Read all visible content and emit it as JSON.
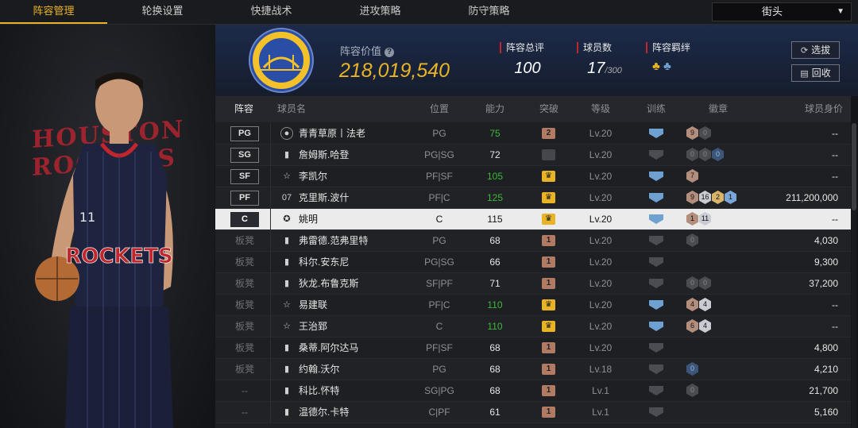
{
  "tabs": [
    {
      "label": "阵容管理",
      "active": true
    },
    {
      "label": "轮换设置",
      "active": false
    },
    {
      "label": "快捷战术",
      "active": false
    },
    {
      "label": "进攻策略",
      "active": false
    },
    {
      "label": "防守策略",
      "active": false
    }
  ],
  "mode_select": {
    "value": "街头"
  },
  "art": {
    "team_text": "HOUSTON ROCKETS",
    "jersey_text": "ROCKETS",
    "jersey_number": "11"
  },
  "header": {
    "value_label": "阵容价值",
    "value": "218,019,540",
    "overall_label": "阵容总评",
    "overall": "100",
    "players_label": "球员数",
    "players": "17",
    "players_max": "/300",
    "bond_label": "阵容羁绊",
    "select_btn": "选拔",
    "recycle_btn": "回收"
  },
  "columns": [
    "阵容",
    "球员名",
    "位置",
    "能力",
    "突破",
    "等级",
    "训练",
    "徽章",
    "球员身价"
  ],
  "rows": [
    {
      "slot": "PG",
      "bench": false,
      "icon": "person",
      "name": "青青草原丨法老",
      "pos": "PG",
      "ability": "75",
      "green": true,
      "brk": "2",
      "brkType": "copper",
      "level": "Lv.20",
      "train": "blue",
      "badges": [
        [
          "copper",
          "9"
        ],
        [
          "dark",
          "0"
        ]
      ],
      "price": "--"
    },
    {
      "slot": "SG",
      "bench": false,
      "icon": "bars",
      "name": "詹姆斯.哈登",
      "pos": "PG|SG",
      "ability": "72",
      "green": false,
      "brk": "",
      "brkType": "dark",
      "level": "Lv.20",
      "train": "gray",
      "badges": [
        [
          "dark",
          "0"
        ],
        [
          "dark",
          "0"
        ],
        [
          "navy",
          "0"
        ]
      ],
      "price": "--"
    },
    {
      "slot": "SF",
      "bench": false,
      "icon": "star",
      "name": "李凯尔",
      "pos": "PF|SF",
      "ability": "105",
      "green": true,
      "brk": "♛",
      "brkType": "gold",
      "level": "Lv.20",
      "train": "blue",
      "badges": [
        [
          "copper",
          "7"
        ]
      ],
      "price": "--"
    },
    {
      "slot": "PF",
      "bench": false,
      "icon": "07",
      "name": "克里斯.波什",
      "pos": "PF|C",
      "ability": "125",
      "green": true,
      "brk": "♛",
      "brkType": "gold",
      "level": "Lv.20",
      "train": "blue",
      "badges": [
        [
          "copper",
          "9"
        ],
        [
          "silver",
          "16"
        ],
        [
          "gold",
          "2"
        ],
        [
          "blue",
          "1"
        ]
      ],
      "price": "211,200,000"
    },
    {
      "slot": "C",
      "bench": false,
      "icon": "legend",
      "name": "姚明",
      "pos": "C",
      "ability": "115",
      "green": false,
      "brk": "♛",
      "brkType": "gold",
      "level": "Lv.20",
      "train": "blue",
      "badges": [
        [
          "copper",
          "1"
        ],
        [
          "silver",
          "11"
        ]
      ],
      "price": "--",
      "selected": true
    },
    {
      "slot": "板凳",
      "bench": true,
      "icon": "bars",
      "name": "弗雷德.范弗里特",
      "pos": "PG",
      "ability": "68",
      "green": false,
      "brk": "1",
      "brkType": "copper",
      "level": "Lv.20",
      "train": "gray",
      "badges": [
        [
          "dark",
          "0"
        ]
      ],
      "price": "4,030"
    },
    {
      "slot": "板凳",
      "bench": true,
      "icon": "bars",
      "name": "科尔.安东尼",
      "pos": "PG|SG",
      "ability": "66",
      "green": false,
      "brk": "1",
      "brkType": "copper",
      "level": "Lv.20",
      "train": "gray",
      "badges": [],
      "price": "9,300"
    },
    {
      "slot": "板凳",
      "bench": true,
      "icon": "bars",
      "name": "狄龙.布鲁克斯",
      "pos": "SF|PF",
      "ability": "71",
      "green": false,
      "brk": "1",
      "brkType": "copper",
      "level": "Lv.20",
      "train": "gray",
      "badges": [
        [
          "dark",
          "0"
        ],
        [
          "dark",
          "0"
        ]
      ],
      "price": "37,200"
    },
    {
      "slot": "板凳",
      "bench": true,
      "icon": "star",
      "name": "易建联",
      "pos": "PF|C",
      "ability": "110",
      "green": true,
      "brk": "♛",
      "brkType": "gold",
      "level": "Lv.20",
      "train": "blue",
      "badges": [
        [
          "copper",
          "4"
        ],
        [
          "silver",
          "4"
        ]
      ],
      "price": "--"
    },
    {
      "slot": "板凳",
      "bench": true,
      "icon": "star",
      "name": "王治郅",
      "pos": "C",
      "ability": "110",
      "green": true,
      "brk": "♛",
      "brkType": "gold",
      "level": "Lv.20",
      "train": "blue",
      "badges": [
        [
          "copper",
          "6"
        ],
        [
          "silver",
          "4"
        ]
      ],
      "price": "--"
    },
    {
      "slot": "板凳",
      "bench": true,
      "icon": "bars",
      "name": "桑蒂.阿尔达马",
      "pos": "PF|SF",
      "ability": "68",
      "green": false,
      "brk": "1",
      "brkType": "copper",
      "level": "Lv.20",
      "train": "gray",
      "badges": [],
      "price": "4,800"
    },
    {
      "slot": "板凳",
      "bench": true,
      "icon": "bars",
      "name": "约翰.沃尔",
      "pos": "PG",
      "ability": "68",
      "green": false,
      "brk": "1",
      "brkType": "copper",
      "level": "Lv.18",
      "train": "gray",
      "badges": [
        [
          "navy",
          "0"
        ]
      ],
      "price": "4,210"
    },
    {
      "slot": "--",
      "bench": true,
      "icon": "bars",
      "name": "科比.怀特",
      "pos": "SG|PG",
      "ability": "68",
      "green": false,
      "brk": "1",
      "brkType": "copper",
      "level": "Lv.1",
      "train": "gray",
      "badges": [
        [
          "dark",
          "0"
        ]
      ],
      "price": "21,700"
    },
    {
      "slot": "--",
      "bench": true,
      "icon": "bars",
      "name": "温德尔.卡特",
      "pos": "C|PF",
      "ability": "61",
      "green": false,
      "brk": "1",
      "brkType": "copper",
      "level": "Lv.1",
      "train": "gray",
      "badges": [],
      "price": "5,160"
    }
  ]
}
